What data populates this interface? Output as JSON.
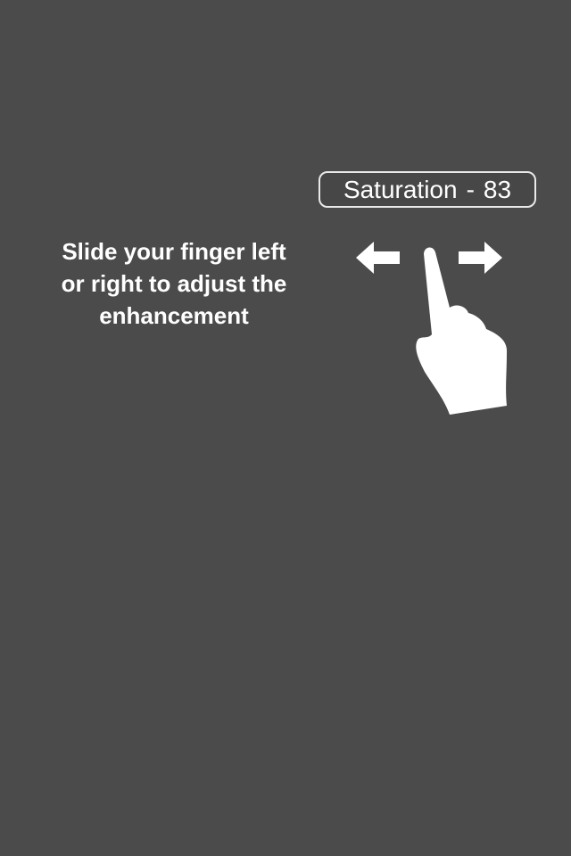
{
  "overlay": {
    "value_label": {
      "name": "Saturation",
      "separator": "-",
      "value": "83"
    },
    "instruction_lines": [
      "Slide your finger left",
      "or right to adjust the",
      "enhancement"
    ],
    "icons": {
      "left_arrow": "arrow-left-icon",
      "right_arrow": "arrow-right-icon",
      "hand": "pointing-hand-icon"
    },
    "colors": {
      "background": "#4b4b4b",
      "foreground": "#ffffff"
    }
  }
}
